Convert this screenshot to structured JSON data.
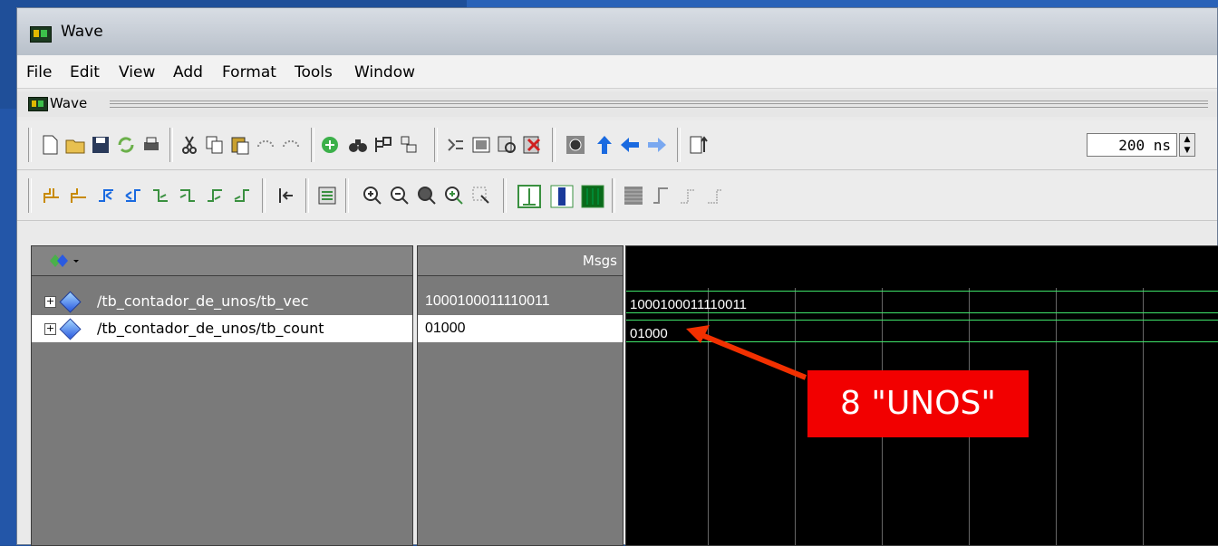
{
  "window": {
    "title": "Wave"
  },
  "menu": [
    "File",
    "Edit",
    "View",
    "Add",
    "Format",
    "Tools",
    "Window"
  ],
  "subwindow": {
    "title": "Wave"
  },
  "toolbar": {
    "time_value": "200 ns"
  },
  "panes": {
    "msgs_header": "Msgs"
  },
  "signals": [
    {
      "name": "/tb_contador_de_unos/tb_vec",
      "value": "1000100011110011",
      "wave_value": "1000100011110011",
      "selected": false
    },
    {
      "name": "/tb_contador_de_unos/tb_count",
      "value": "01000",
      "wave_value": "01000",
      "selected": true
    }
  ],
  "annotation": {
    "text": "8 \"UNOS\"",
    "color": "#f20000"
  }
}
